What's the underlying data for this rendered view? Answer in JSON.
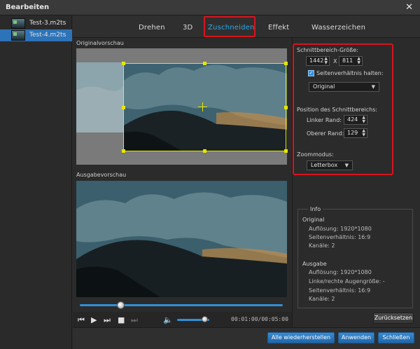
{
  "window": {
    "title": "Bearbeiten",
    "close_glyph": "✕"
  },
  "files": [
    {
      "name": "Test-3.m2ts",
      "selected": false
    },
    {
      "name": "Test-4.m2ts",
      "selected": true
    }
  ],
  "tabs": [
    {
      "label": "Drehen",
      "active": false
    },
    {
      "label": "3D",
      "active": false
    },
    {
      "label": "Zuschneiden",
      "active": true
    },
    {
      "label": "Effekt",
      "active": false
    },
    {
      "label": "Wasserzeichen",
      "active": false
    }
  ],
  "preview": {
    "original_label": "Originalvorschau",
    "output_label": "Ausgabevorschau"
  },
  "crop": {
    "area_size_label": "Schnittbereich-Größe:",
    "width": "1442",
    "times": "X",
    "height": "811",
    "keep_ratio_label": "Seitenverhältnis halten:",
    "keep_ratio_checked": true,
    "ratio_value": "Original",
    "position_label": "Position des Schnittbereichs:",
    "left_label": "Linker Rand:",
    "left_value": "424",
    "top_label": "Oberer Rand:",
    "top_value": "129",
    "zoom_label": "Zoommodus:",
    "zoom_value": "Letterbox"
  },
  "info": {
    "title": "Info",
    "original_heading": "Original",
    "original_resolution": "Auflösung: 1920*1080",
    "original_aspect": "Seitenverhältnis: 16:9",
    "original_channels": "Kanäle: 2",
    "output_heading": "Ausgabe",
    "output_resolution": "Auflösung: 1920*1080",
    "output_eye": "Linke/rechte Augengröße: -",
    "output_aspect": "Seitenverhältnis: 16:9",
    "output_channels": "Kanäle: 2"
  },
  "player": {
    "timecode": "00:01:00/00:05:00",
    "progress_fraction": 0.2,
    "volume_fraction": 0.85
  },
  "buttons": {
    "reset": "Zurücksetzen",
    "restore_all": "Alle wiederherstellen",
    "apply": "Anwenden",
    "close": "Schließen"
  },
  "colors": {
    "accent_blue": "#2d73b8",
    "active_tab": "#2fa7e8",
    "highlight_red": "#d8141e",
    "crop_frame": "#e6e600"
  }
}
